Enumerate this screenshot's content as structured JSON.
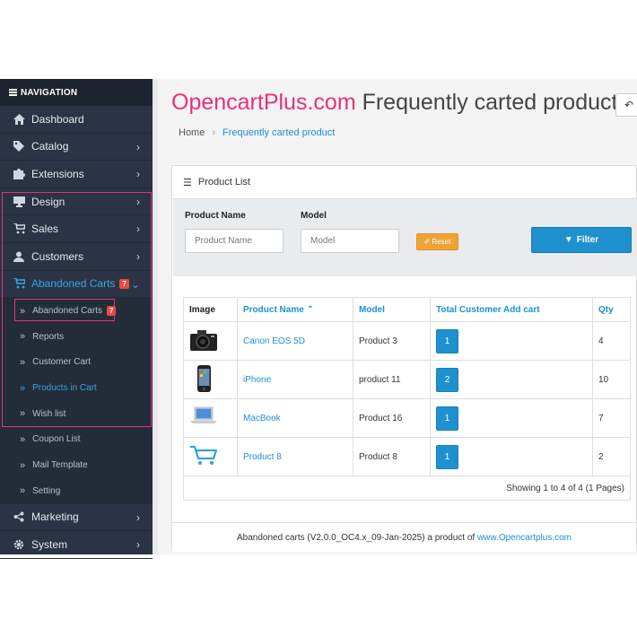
{
  "sidebar": {
    "header": "NAVIGATION",
    "items": [
      {
        "label": "Dashboard",
        "icon": "dashboard-icon"
      },
      {
        "label": "Catalog",
        "icon": "tag-icon"
      },
      {
        "label": "Extensions",
        "icon": "puzzle-icon"
      },
      {
        "label": "Design",
        "icon": "monitor-icon"
      },
      {
        "label": "Sales",
        "icon": "cart-icon"
      },
      {
        "label": "Customers",
        "icon": "user-icon"
      },
      {
        "label": "Abandoned Carts",
        "icon": "cart-icon",
        "badge": "7"
      },
      {
        "label": "Marketing",
        "icon": "share-icon"
      },
      {
        "label": "System",
        "icon": "gear-icon"
      }
    ],
    "sub_items": [
      {
        "label": "Abandoned Carts",
        "badge": "7"
      },
      {
        "label": "Reports"
      },
      {
        "label": "Customer Cart"
      },
      {
        "label": "Products in Cart"
      },
      {
        "label": "Wish list"
      },
      {
        "label": "Coupon List"
      },
      {
        "label": "Mail Template"
      },
      {
        "label": "Setting"
      }
    ]
  },
  "header": {
    "brand": "OpencartPlus.com",
    "title": " Frequently carted product",
    "breadcrumb": [
      "Home",
      "Frequently carted product"
    ]
  },
  "panel": {
    "title": "Product List",
    "filter": {
      "product_name_label": "Product Name",
      "product_name_placeholder": "Product Name",
      "model_label": "Model",
      "model_placeholder": "Model",
      "reset_label": "Reset",
      "filter_label": "Filter"
    },
    "table": {
      "headers": [
        "Image",
        "Product Name",
        "Model",
        "Total Customer Add cart",
        "Qty"
      ],
      "rows": [
        {
          "name": "Canon EOS 5D",
          "model": "Product 3",
          "count": "1",
          "qty": "4",
          "image": "camera-image"
        },
        {
          "name": "iPhone",
          "model": "product 11",
          "count": "2",
          "qty": "10",
          "image": "phone-image"
        },
        {
          "name": "MacBook",
          "model": "Product 16",
          "count": "1",
          "qty": "7",
          "image": "laptop-image"
        },
        {
          "name": "Product 8",
          "model": "Product 8",
          "count": "1",
          "qty": "2",
          "image": "cart-image"
        }
      ],
      "pager": "Showing 1 to 4 of 4 (1 Pages)"
    }
  },
  "footer": {
    "text": "Abandoned carts (V2.0.0_OC4.x_09-Jan-2025) a product of ",
    "link": "www.Opencartplus.com"
  },
  "colors": {
    "brand": "#e8317a",
    "accent": "#1e91cf",
    "sidebar": "#2a3444",
    "reset": "#f0a335"
  }
}
